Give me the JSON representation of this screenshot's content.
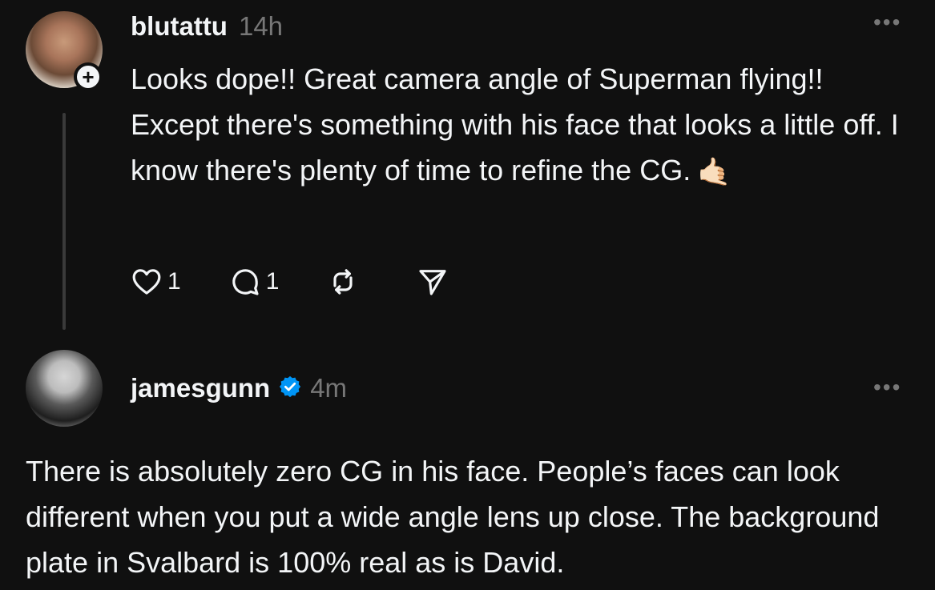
{
  "posts": [
    {
      "username": "blutattu",
      "time": "14h",
      "more": "•••",
      "follow_symbol": "+",
      "text": "Looks dope!! Great camera angle of Superman flying!! Except there's something with his face that looks a little off. I know there's plenty of time to refine the CG.",
      "emoji": "🤙🏻",
      "likes": "1",
      "replies": "1"
    },
    {
      "username": "jamesgunn",
      "time": "4m",
      "verified": true,
      "more": "•••",
      "text": "There is absolutely zero CG in his face. People’s faces can look different when you put a wide angle lens up close. The background plate in Svalbard is 100% real as is David."
    }
  ],
  "colors": {
    "background": "#101010",
    "text": "#f3f5f7",
    "secondary": "#777777",
    "verified": "#0095f6"
  },
  "icons": [
    "heart-icon",
    "comment-icon",
    "repost-icon",
    "share-icon",
    "verified-badge-icon",
    "more-icon",
    "follow-plus-icon"
  ]
}
